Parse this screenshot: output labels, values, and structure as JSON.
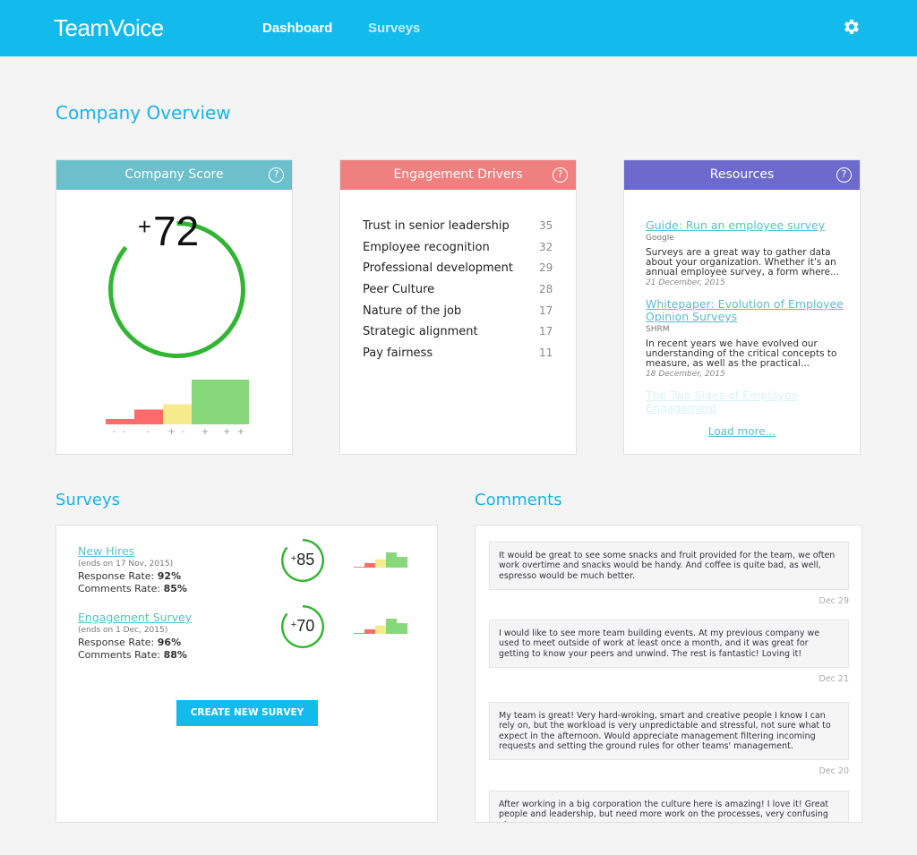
{
  "header": {
    "logo": "TeamVoice",
    "nav": [
      {
        "label": "Dashboard",
        "active": true
      },
      {
        "label": "Surveys",
        "active": false
      }
    ],
    "settings_icon": "gear-icon",
    "brand_color": "#13bbec"
  },
  "page_title": "Company Overview",
  "company_score": {
    "title": "Company Score",
    "header_color": "#6cc0cc",
    "help_icon": "?",
    "score_sign": "+",
    "score": "72",
    "gauge_fraction": 0.86,
    "distribution": {
      "labels": [
        "- -",
        "-",
        "+ -",
        "+",
        "+ +"
      ],
      "values": [
        0.12,
        0.33,
        0.45,
        1.0,
        1.0
      ],
      "colors": [
        "#fd6b6b",
        "#fd6b6b",
        "#f5eb8c",
        "#87d87a",
        "#87d87a"
      ]
    }
  },
  "engagement_drivers": {
    "title": "Engagement Drivers",
    "header_color": "#f08080",
    "help_icon": "?",
    "items": [
      {
        "label": "Trust in senior leadership",
        "value": "35"
      },
      {
        "label": "Employee recognition",
        "value": "32"
      },
      {
        "label": "Professional development",
        "value": "29"
      },
      {
        "label": "Peer Culture",
        "value": "28"
      },
      {
        "label": "Nature of the job",
        "value": "17"
      },
      {
        "label": "Strategic alignment",
        "value": "17"
      },
      {
        "label": "Pay fairness",
        "value": "11"
      }
    ]
  },
  "resources": {
    "title": "Resources",
    "header_color": "#6c6acc",
    "help_icon": "?",
    "items": [
      {
        "title": "Guide: Run an employee survey",
        "source": "Google",
        "description": "Surveys are a great way to gather data about your organization. Whether it's an annual employee survey, a form where...",
        "date": "21 December, 2015"
      },
      {
        "title": "Whitepaper: Evolution of Employee Opinion Surveys",
        "source": "SHRM",
        "description": "In recent years we have evolved our understanding of the critical concepts to measure, as well as the practical...",
        "date": "18 December, 2015"
      },
      {
        "title": "The Two Sides of Employee Engagement"
      }
    ],
    "load_more": "Load more..."
  },
  "surveys": {
    "title": "Surveys",
    "items": [
      {
        "name": "New Hires",
        "ends": "(ends on 17 Nov, 2015)",
        "response_label": "Response Rate:",
        "response_rate": "92%",
        "comments_label": "Comments Rate:",
        "comments_rate": "85%",
        "score_sign": "+",
        "score": "85",
        "gauge_fraction": 0.86,
        "distribution": [
          0.05,
          0.3,
          0.55,
          1.0,
          0.7
        ]
      },
      {
        "name": "Engagement Survey",
        "ends": "(ends on 1 Dec, 2015)",
        "response_label": "Response Rate:",
        "response_rate": "96%",
        "comments_label": "Comments Rate:",
        "comments_rate": "88%",
        "score_sign": "+",
        "score": "70",
        "gauge_fraction": 0.86,
        "distribution": [
          0.05,
          0.3,
          0.55,
          1.0,
          0.7
        ]
      }
    ],
    "create_button": "CREATE NEW SURVEY"
  },
  "comments": {
    "title": "Comments",
    "items": [
      {
        "text": "It would be great to see some snacks and fruit provided for the team, we often work overtime and snacks would be handy. And coffee is quite bad, as well, espresso would be much better.",
        "date": "Dec 29"
      },
      {
        "text": "I would like to see more team building events. At my previous company we used to meet outside of work at least once a month, and it was great for getting to know your peers and unwind. The rest is fantastic! Loving it!",
        "date": "Dec 21"
      },
      {
        "text": "My team is great! Very hard-wroking, smart and creative people I know I can rely on, but the workload is very unpredictable and stressful, not sure what to expect in the afternoon. Would appreciate management filtering incoming requests and setting the ground rules for other teams' management.",
        "date": "Dec 20"
      },
      {
        "text": "After working in a big corporation the culture here is amazing! I love it! Great people and leadership, but need more work on the processes, very confusing at",
        "date": ""
      }
    ]
  }
}
